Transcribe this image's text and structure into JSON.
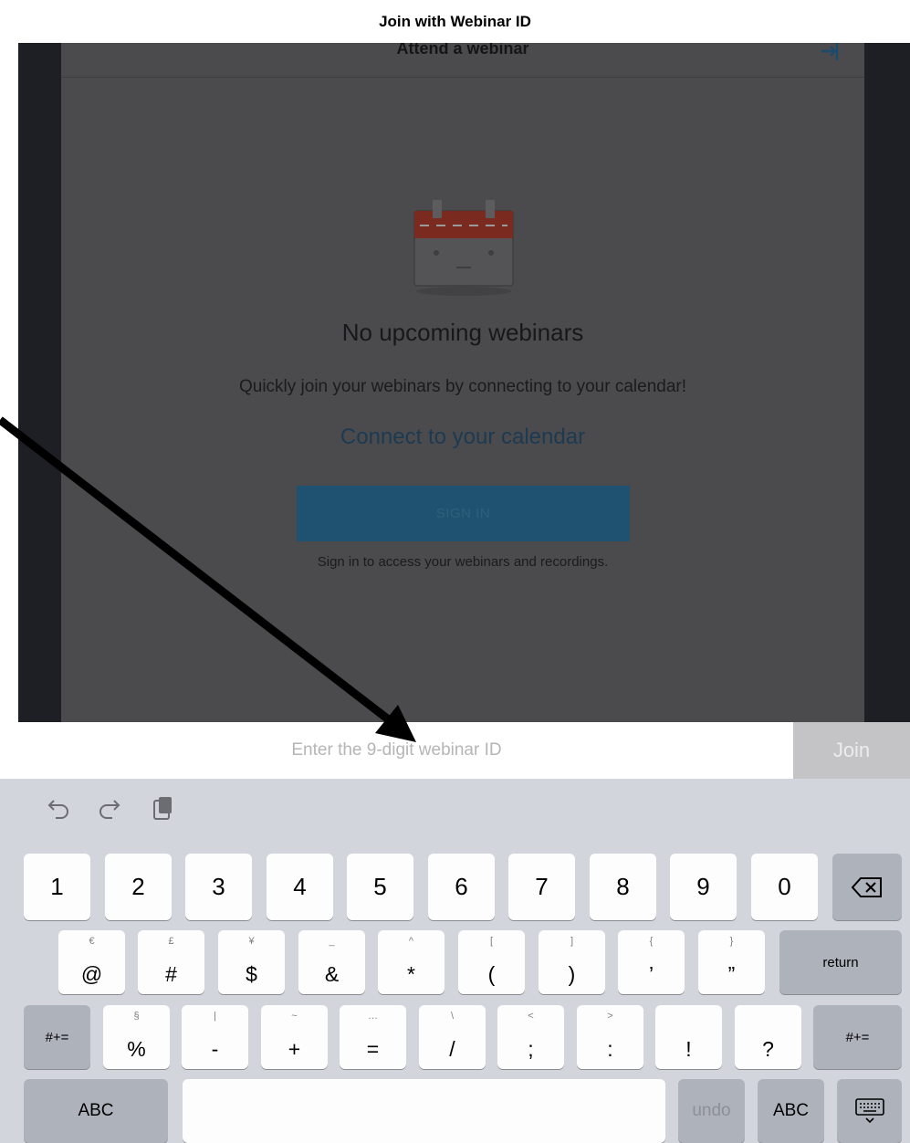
{
  "caption": "Join with Webinar ID",
  "nav": {
    "title": "Attend a webinar",
    "signin_icon": "sign-in-icon"
  },
  "empty_state": {
    "icon": "calendar-icon",
    "headline": "No upcoming webinars",
    "subtitle": "Quickly join your webinars by connecting to your calendar!",
    "connect_link": "Connect to your calendar",
    "signin_button": "SIGN IN",
    "signin_note": "Sign in to access your webinars and recordings."
  },
  "input": {
    "placeholder": "Enter the 9-digit webinar ID",
    "join_label": "Join"
  },
  "keyboard": {
    "toolbar": [
      "undo-icon",
      "redo-icon",
      "paste-icon"
    ],
    "row1": [
      "1",
      "2",
      "3",
      "4",
      "5",
      "6",
      "7",
      "8",
      "9",
      "0"
    ],
    "row2": [
      {
        "alt": "€",
        "main": "@"
      },
      {
        "alt": "£",
        "main": "#"
      },
      {
        "alt": "¥",
        "main": "$"
      },
      {
        "alt": "_",
        "main": "&"
      },
      {
        "alt": "^",
        "main": "*"
      },
      {
        "alt": "[",
        "main": "("
      },
      {
        "alt": "]",
        "main": ")"
      },
      {
        "alt": "{",
        "main": "’"
      },
      {
        "alt": "}",
        "main": "”"
      }
    ],
    "return_label": "return",
    "row3": [
      {
        "alt": "§",
        "main": "%"
      },
      {
        "alt": "|",
        "main": "-"
      },
      {
        "alt": "~",
        "main": "+"
      },
      {
        "alt": "…",
        "main": "="
      },
      {
        "alt": "\\",
        "main": "/"
      },
      {
        "alt": "<",
        "main": ";"
      },
      {
        "alt": ">",
        "main": ":"
      },
      {
        "alt": "",
        "main": "!"
      },
      {
        "alt": "",
        "main": "?"
      }
    ],
    "shift_label": "#+=",
    "abc_label": "ABC",
    "undo_label": "undo",
    "hide_icon": "keyboard-hide-icon"
  },
  "colors": {
    "accent": "#1e5270",
    "backdrop": "#1e1f24",
    "keyboard_bg": "#d2d5db"
  }
}
